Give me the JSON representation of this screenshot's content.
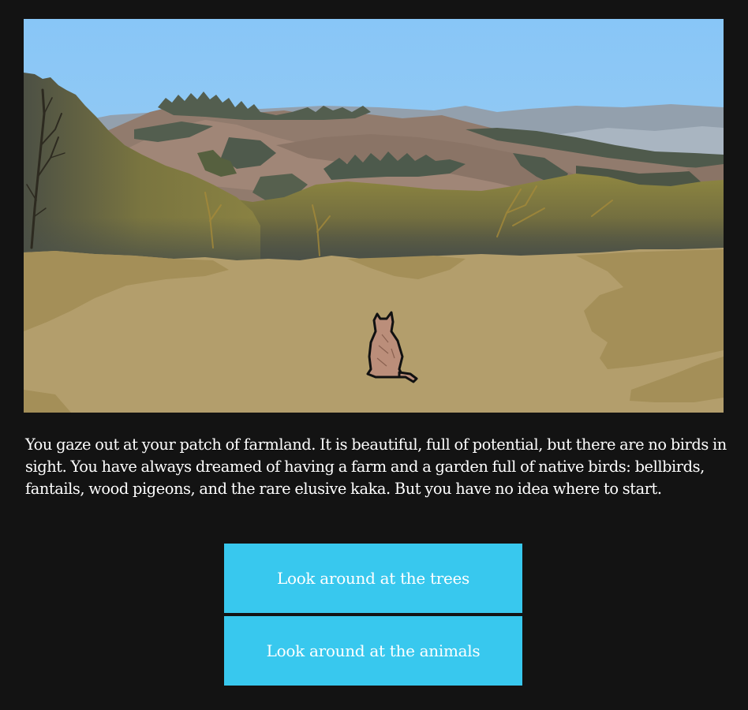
{
  "story": {
    "text": "You gaze out at your patch of farmland. It is beautiful, full of potential, but there are no birds in sight. You have always dreamed of having a farm and a garden full of native birds: bellbirds, fantails, wood pigeons, and the rare elusive kaka. But you have no idea where to start."
  },
  "choices": [
    {
      "label": "Look around at the trees"
    },
    {
      "label": "Look around at the animals"
    }
  ],
  "colors": {
    "page_background": "#131313",
    "button_background": "#38c8ee",
    "button_text": "#ffffff",
    "story_text": "#ffffff"
  }
}
